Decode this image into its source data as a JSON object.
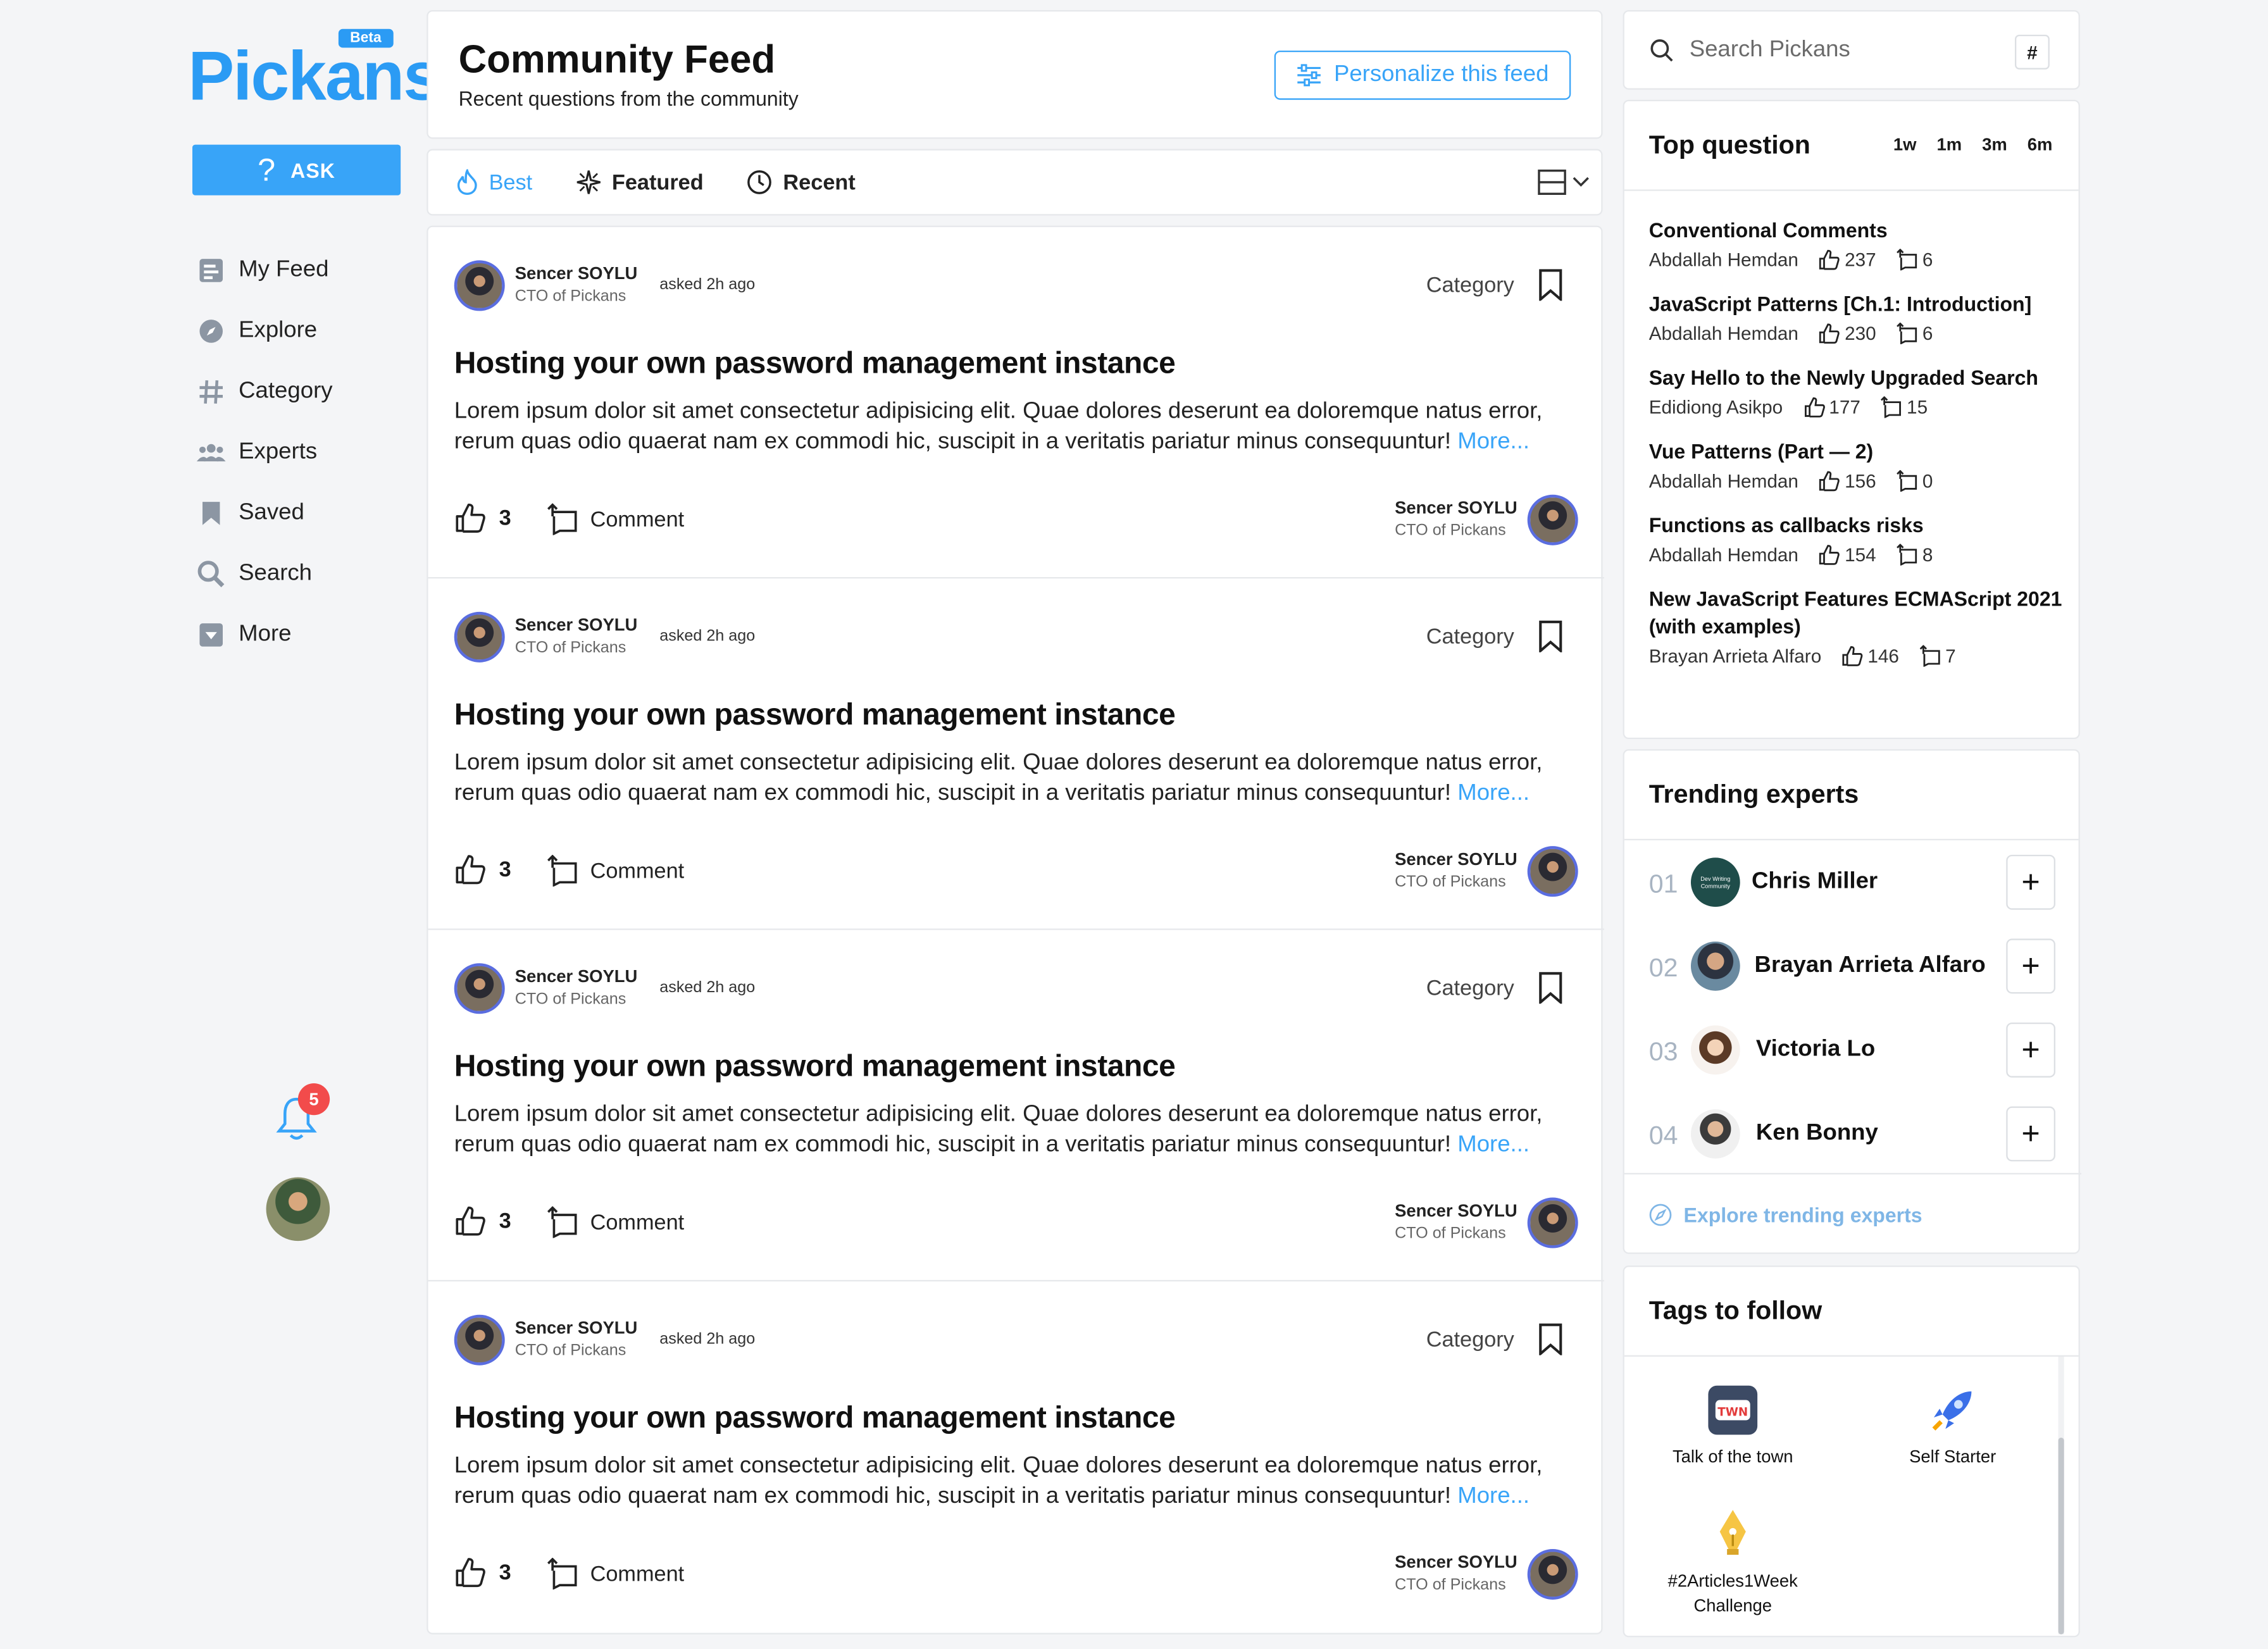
{
  "brand": {
    "name": "Pickans",
    "badge": "Beta"
  },
  "sidebar": {
    "ask_label": "ASK",
    "items": [
      {
        "label": "My Feed",
        "icon": "feed-icon"
      },
      {
        "label": "Explore",
        "icon": "compass-icon"
      },
      {
        "label": "Category",
        "icon": "hash-icon"
      },
      {
        "label": "Experts",
        "icon": "users-icon"
      },
      {
        "label": "Saved",
        "icon": "bookmark-icon"
      },
      {
        "label": "Search",
        "icon": "search-icon"
      },
      {
        "label": "More",
        "icon": "caret-down-icon"
      }
    ],
    "notification_count": "5"
  },
  "feed": {
    "title": "Community Feed",
    "subtitle": "Recent questions from the community",
    "personalize_label": "Personalize this feed",
    "tabs": [
      {
        "label": "Best",
        "icon": "flame-icon"
      },
      {
        "label": "Featured",
        "icon": "sparkle-icon"
      },
      {
        "label": "Recent",
        "icon": "clock-icon"
      }
    ],
    "posts": [
      {
        "author": "Sencer SOYLU",
        "role": "CTO of Pickans",
        "asked": "asked 2h ago",
        "category": "Category",
        "title": "Hosting your own password management instance",
        "body": "Lorem ipsum dolor sit amet consectetur adipisicing elit. Quae dolores deserunt ea doloremque natus error, rerum quas odio quaerat nam ex commodi hic, suscipit in a veritatis pariatur minus consequuntur!",
        "more": "More...",
        "likes": "3",
        "comment_label": "Comment",
        "answerer": "Sencer SOYLU",
        "answerer_role": "CTO of Pickans"
      },
      {
        "author": "Sencer SOYLU",
        "role": "CTO of Pickans",
        "asked": "asked 2h ago",
        "category": "Category",
        "title": "Hosting your own password management instance",
        "body": "Lorem ipsum dolor sit amet consectetur adipisicing elit. Quae dolores deserunt ea doloremque natus error, rerum quas odio quaerat nam ex commodi hic, suscipit in a veritatis pariatur minus consequuntur!",
        "more": "More...",
        "likes": "3",
        "comment_label": "Comment",
        "answerer": "Sencer SOYLU",
        "answerer_role": "CTO of Pickans"
      },
      {
        "author": "Sencer SOYLU",
        "role": "CTO of Pickans",
        "asked": "asked 2h ago",
        "category": "Category",
        "title": "Hosting your own password management instance",
        "body": "Lorem ipsum dolor sit amet consectetur adipisicing elit. Quae dolores deserunt ea doloremque natus error, rerum quas odio quaerat nam ex commodi hic, suscipit in a veritatis pariatur minus consequuntur!",
        "more": "More...",
        "likes": "3",
        "comment_label": "Comment",
        "answerer": "Sencer SOYLU",
        "answerer_role": "CTO of Pickans"
      },
      {
        "author": "Sencer SOYLU",
        "role": "CTO of Pickans",
        "asked": "asked 2h ago",
        "category": "Category",
        "title": "Hosting your own password management instance",
        "body": "Lorem ipsum dolor sit amet consectetur adipisicing elit. Quae dolores deserunt ea doloremque natus error, rerum quas odio quaerat nam ex commodi hic, suscipit in a veritatis pariatur minus consequuntur!",
        "more": "More...",
        "likes": "3",
        "comment_label": "Comment",
        "answerer": "Sencer SOYLU",
        "answerer_role": "CTO of Pickans"
      }
    ]
  },
  "search": {
    "placeholder": "Search Pickans",
    "shortcut": "#"
  },
  "top_question": {
    "title": "Top question",
    "ranges": [
      "1w",
      "1m",
      "3m",
      "6m"
    ],
    "items": [
      {
        "title": "Conventional Comments",
        "author": "Abdallah Hemdan",
        "likes": "237",
        "answers": "6"
      },
      {
        "title": "JavaScript Patterns [Ch.1: Introduction]",
        "author": "Abdallah Hemdan",
        "likes": "230",
        "answers": "6"
      },
      {
        "title": "Say Hello to the Newly Upgraded Search",
        "author": "Edidiong Asikpo",
        "likes": "177",
        "answers": "15"
      },
      {
        "title": "Vue Patterns (Part — 2)",
        "author": "Abdallah Hemdan",
        "likes": "156",
        "answers": "0"
      },
      {
        "title": "Functions as callbacks risks",
        "author": "Abdallah Hemdan",
        "likes": "154",
        "answers": "8"
      },
      {
        "title": "New JavaScript Features ECMAScript 2021 (with examples)",
        "author": "Brayan Arrieta Alfaro",
        "likes": "146",
        "answers": "7"
      }
    ]
  },
  "trending": {
    "title": "Trending experts",
    "experts": [
      {
        "rank": "01",
        "name": "Chris Miller",
        "avatar_text": "Dev Writing Community"
      },
      {
        "rank": "02",
        "name": "Brayan Arrieta Alfaro",
        "avatar_text": ""
      },
      {
        "rank": "03",
        "name": "Victoria Lo",
        "avatar_text": ""
      },
      {
        "rank": "04",
        "name": "Ken Bonny",
        "avatar_text": ""
      }
    ],
    "explore_label": "Explore trending experts"
  },
  "tags": {
    "title": "Tags to follow",
    "items": [
      {
        "label": "Talk of the town",
        "icon": "town-badge-icon"
      },
      {
        "label": "Self Starter",
        "icon": "rocket-icon"
      },
      {
        "label": "#2Articles1Week Challenge",
        "icon": "pen-nib-icon"
      }
    ]
  },
  "colors": {
    "accent": "#38a4f8",
    "badge": "#f24b4b",
    "muted_rank": "#a8b4c2"
  }
}
